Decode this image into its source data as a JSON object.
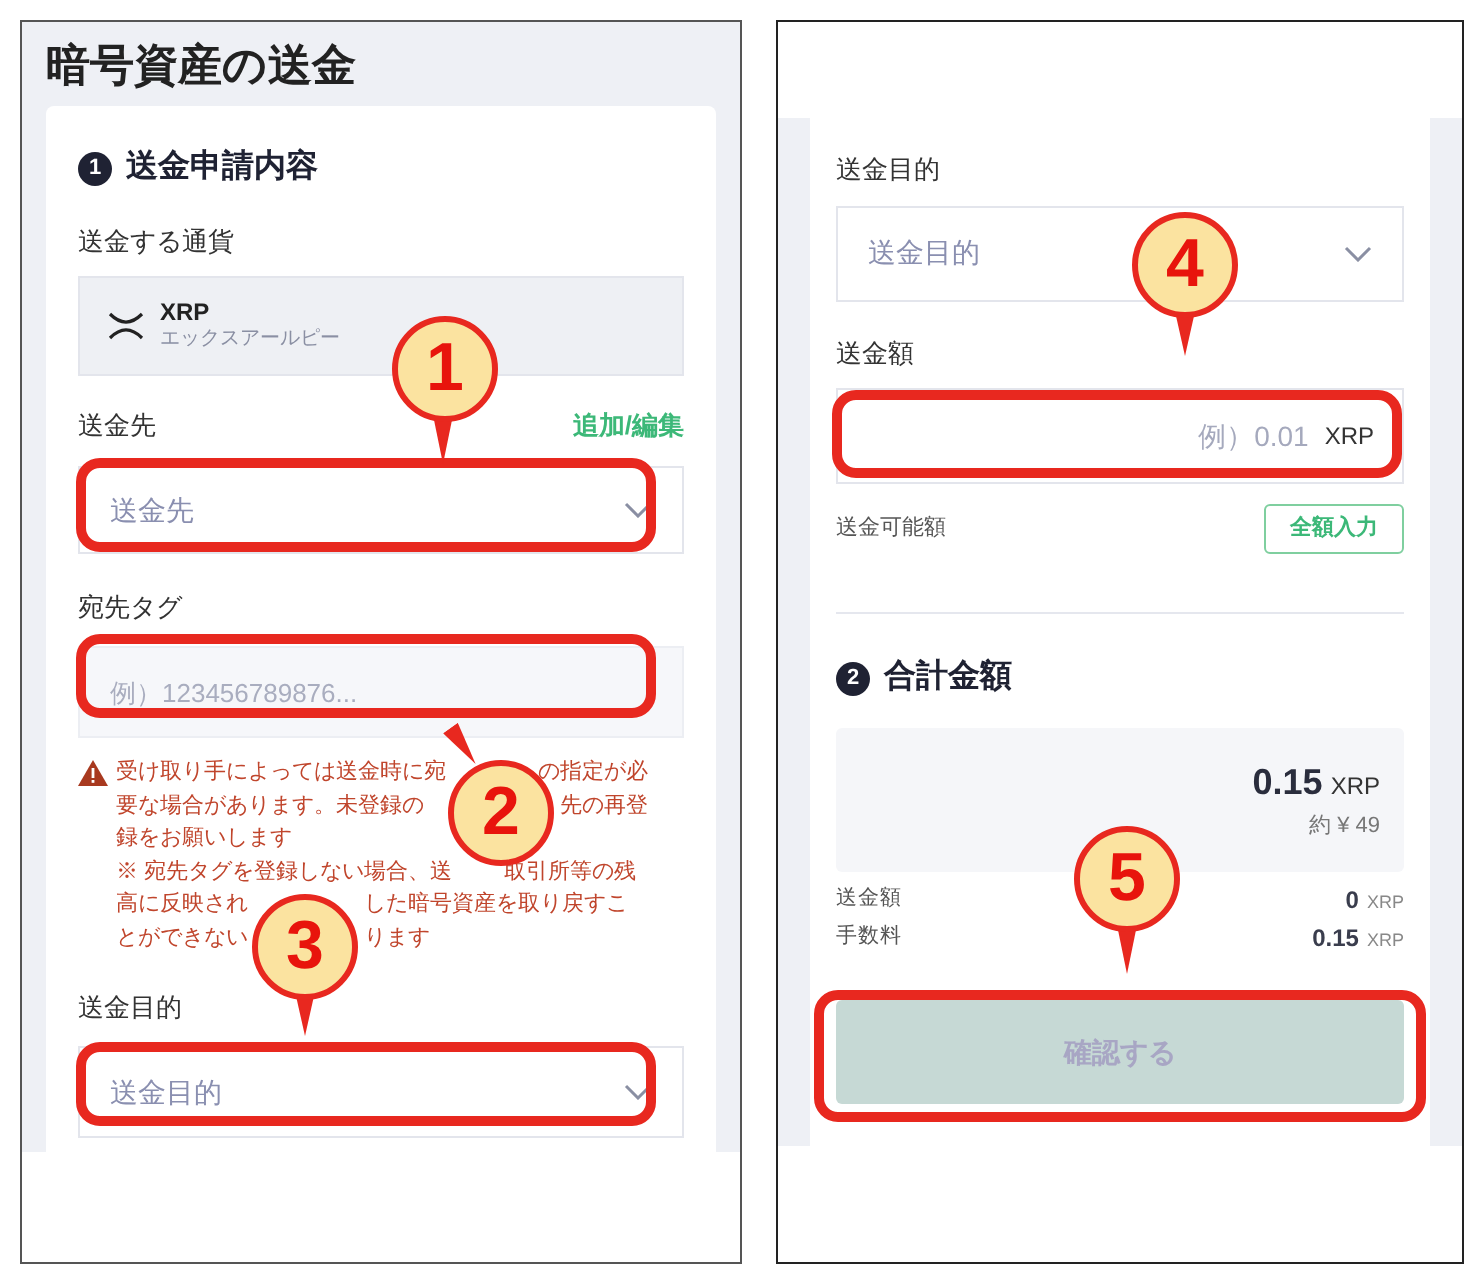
{
  "left": {
    "title": "暗号資産の送金",
    "section": {
      "number": "1",
      "title": "送金申請内容"
    },
    "currency_label": "送金する通貨",
    "currency": {
      "symbol": "XRP",
      "name": "エックスアールピー"
    },
    "recipient": {
      "label": "送金先",
      "action": "追加/編集",
      "placeholder": "送金先"
    },
    "tag": {
      "label": "宛先タグ",
      "placeholder": "例）123456789876..."
    },
    "warning_lines": [
      [
        "受け取り手によっては送金時に宛",
        "の指定が必"
      ],
      [
        "要な場合があります。未登録の",
        "先の再登"
      ],
      [
        "録をお願いします"
      ],
      [
        "※ 宛先タグを登録しない場合、送",
        "取引所等の残"
      ],
      [
        "高に反映され",
        "した暗号資産を取り戻すこ"
      ],
      [
        "とができない",
        "ります"
      ]
    ],
    "purpose": {
      "label": "送金目的",
      "placeholder": "送金目的"
    }
  },
  "right": {
    "purpose": {
      "label": "送金目的",
      "placeholder": "送金目的"
    },
    "amount": {
      "label": "送金額",
      "placeholder": "例）0.01",
      "unit": "XRP"
    },
    "available_label": "送金可能額",
    "fill_all_button": "全額入力",
    "section": {
      "number": "2",
      "title": "合計金額"
    },
    "total": {
      "amount": "0.15",
      "unit": "XRP",
      "approx": "約 ¥ 49"
    },
    "breakdown": [
      {
        "label": "送金額",
        "value": "0",
        "unit": "XRP"
      },
      {
        "label": "手数料",
        "value": "0.15",
        "unit": "XRP"
      }
    ],
    "confirm_button": {
      "label": "確認する",
      "disabled": true
    }
  },
  "callouts": [
    {
      "number": "1"
    },
    {
      "number": "2"
    },
    {
      "number": "3"
    },
    {
      "number": "4"
    },
    {
      "number": "5"
    }
  ]
}
